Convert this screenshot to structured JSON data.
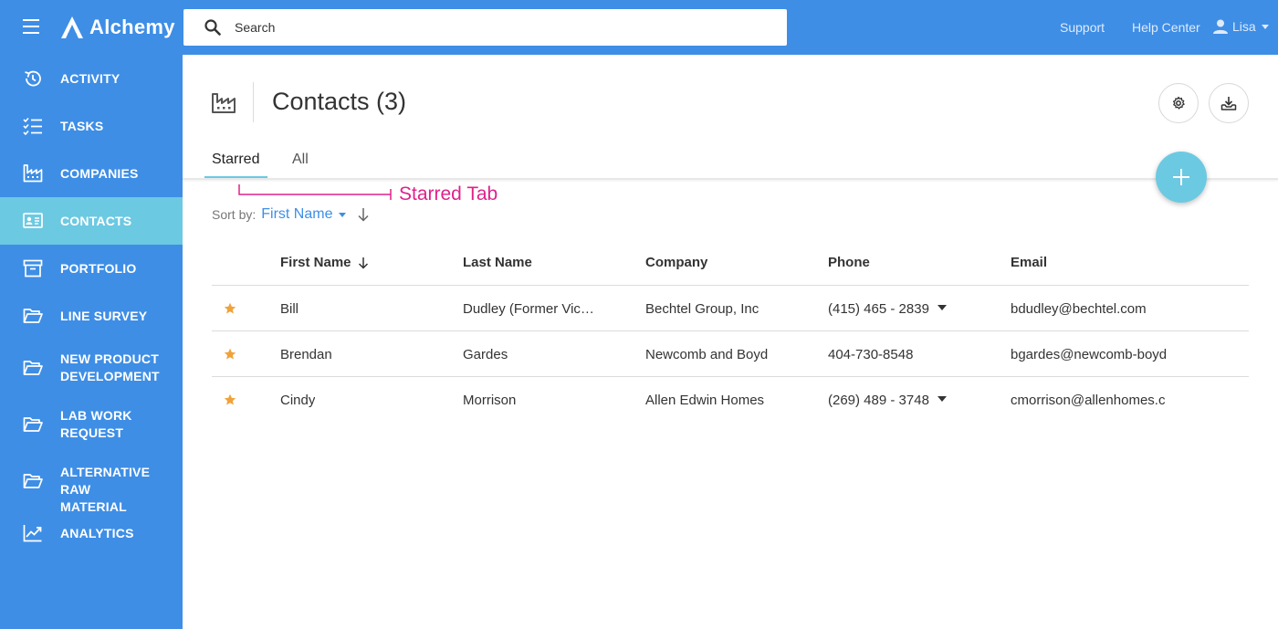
{
  "header": {
    "brand": "Alchemy",
    "search_placeholder": "Search",
    "support_label": "Support",
    "help_label": "Help Center",
    "user_name": "Lisa"
  },
  "sidebar": {
    "items": [
      {
        "label": "ACTIVITY",
        "icon": "history-icon"
      },
      {
        "label": "TASKS",
        "icon": "checklist-icon"
      },
      {
        "label": "COMPANIES",
        "icon": "factory-icon"
      },
      {
        "label": "CONTACTS",
        "icon": "contact-card-icon",
        "active": true
      },
      {
        "label": "PORTFOLIO",
        "icon": "archive-icon"
      },
      {
        "label": "LINE SURVEY",
        "icon": "folder-open-icon"
      },
      {
        "label": "NEW PRODUCT\nDEVELOPMENT",
        "icon": "folder-open-icon"
      },
      {
        "label": "LAB WORK\nREQUEST",
        "icon": "folder-open-icon"
      },
      {
        "label": "ALTERNATIVE RAW\nMATERIAL",
        "icon": "folder-open-icon"
      },
      {
        "label": "ANALYTICS",
        "icon": "trending-up-icon"
      }
    ]
  },
  "main": {
    "title": "Contacts (3)",
    "tabs": [
      {
        "label": "Starred",
        "active": true
      },
      {
        "label": "All",
        "active": false
      }
    ],
    "annotation": "Starred Tab",
    "sort": {
      "label": "Sort by:",
      "value": "First Name"
    },
    "columns": [
      "First Name",
      "Last Name",
      "Company",
      "Phone",
      "Email"
    ],
    "rows": [
      {
        "first": "Bill",
        "last": "Dudley (Former Vic…",
        "company": "Bechtel Group, Inc",
        "phone": "(415) 465 - 2839",
        "phone_dropdown": true,
        "email": "bdudley@bechtel.com"
      },
      {
        "first": "Brendan",
        "last": "Gardes",
        "company": "Newcomb and Boyd",
        "phone": "404-730-8548",
        "phone_dropdown": false,
        "email": "bgardes@newcomb-boyd"
      },
      {
        "first": "Cindy",
        "last": "Morrison",
        "company": "Allen Edwin Homes",
        "phone": "(269) 489 - 3748",
        "phone_dropdown": true,
        "email": "cmorrison@allenhomes.c"
      }
    ]
  },
  "colors": {
    "primary": "#3e8ee6",
    "accent": "#6cc9e2",
    "star": "#f0a23a",
    "annotation": "#e0218a"
  }
}
